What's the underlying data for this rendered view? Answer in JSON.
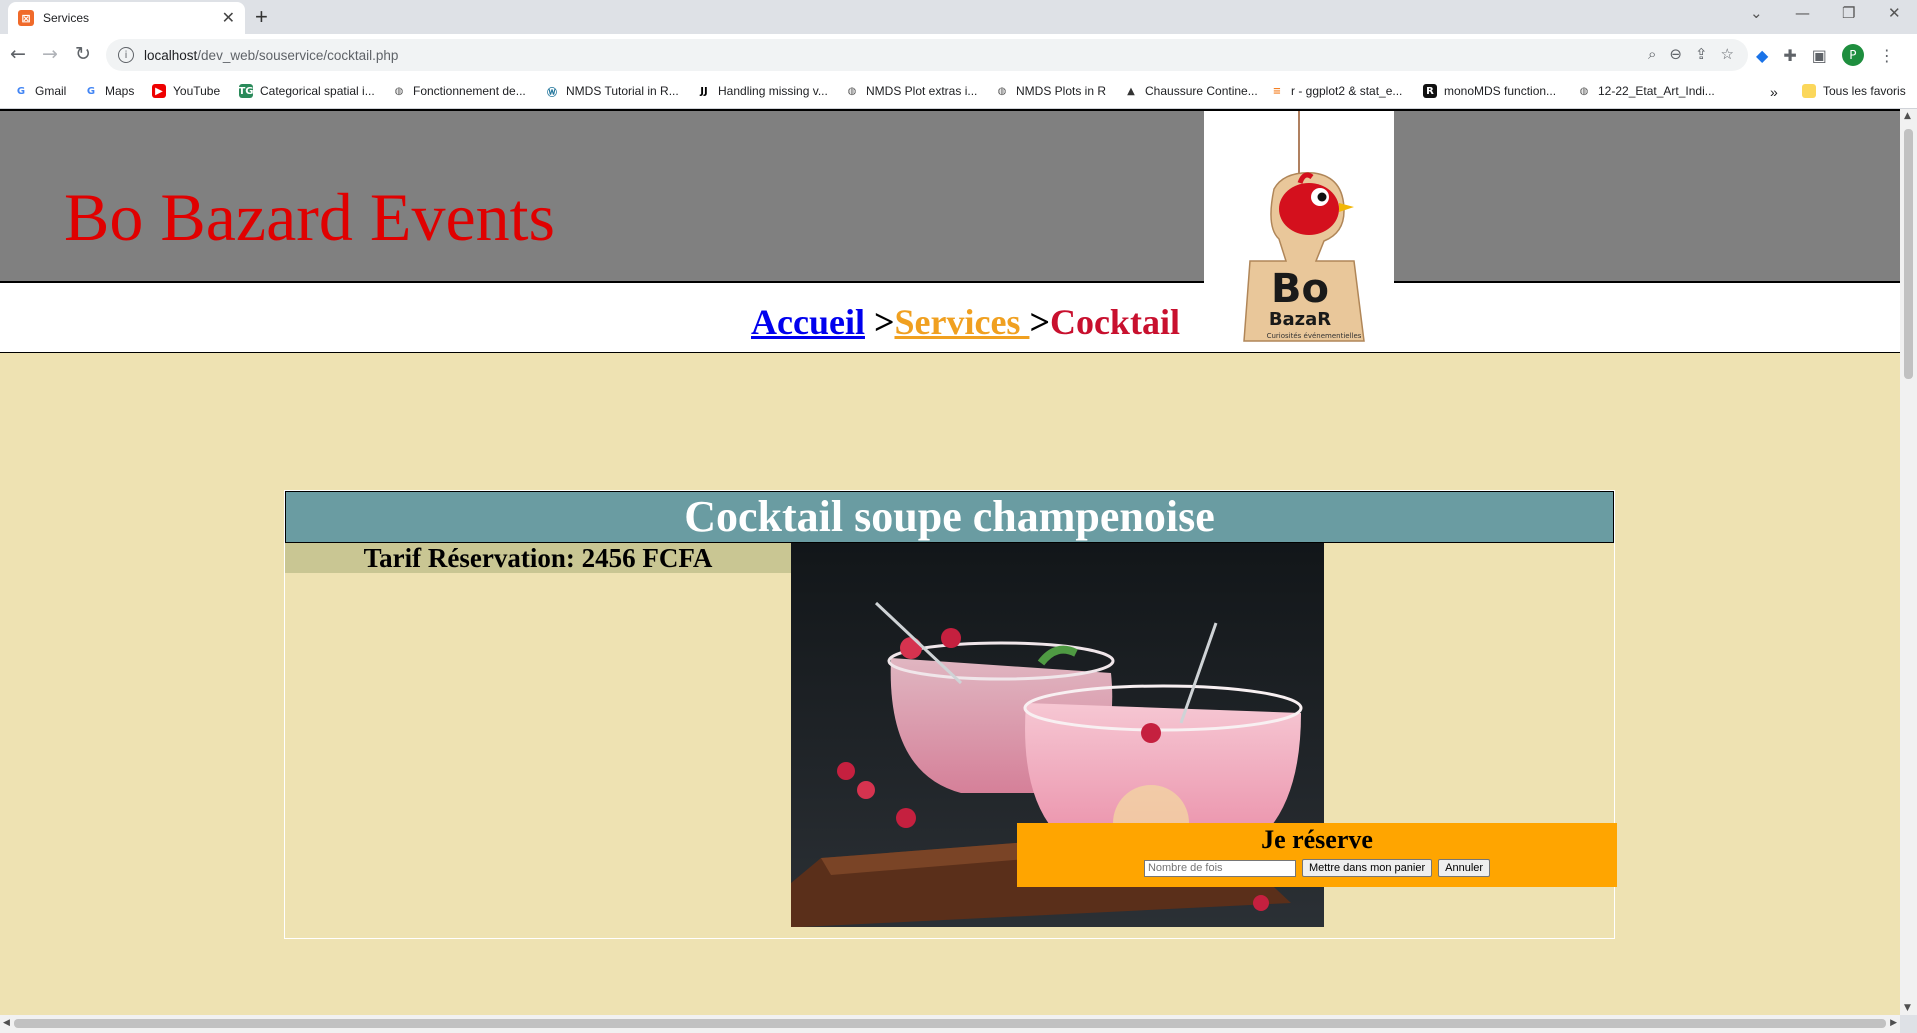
{
  "browser": {
    "tab_title": "Services",
    "tab_favicon": "xampp-icon",
    "url_host": "localhost",
    "url_path": "/dev_web/souservice/cocktail.php",
    "profile_initial": "P",
    "bookmarks": [
      {
        "label": "Gmail",
        "icon": "google-icon"
      },
      {
        "label": "Maps",
        "icon": "google-icon"
      },
      {
        "label": "YouTube",
        "icon": "youtube-icon"
      },
      {
        "label": "Categorical spatial i...",
        "icon": "tg-icon"
      },
      {
        "label": "Fonctionnement de...",
        "icon": "globe-icon"
      },
      {
        "label": "NMDS Tutorial in R...",
        "icon": "wordpress-icon"
      },
      {
        "label": "Handling missing v...",
        "icon": "jj-icon"
      },
      {
        "label": "NMDS Plot extras i...",
        "icon": "globe-icon"
      },
      {
        "label": "NMDS Plots in R",
        "icon": "globe-icon"
      },
      {
        "label": "Chaussure Contine...",
        "icon": "mountain-icon"
      },
      {
        "label": "r - ggplot2 & stat_e...",
        "icon": "stackoverflow-icon"
      },
      {
        "label": "monoMDS function...",
        "icon": "r-icon"
      },
      {
        "label": "12-22_Etat_Art_Indi...",
        "icon": "globe-icon"
      }
    ],
    "overflow_label": "»",
    "all_bookmarks_label": "Tous les favoris"
  },
  "page": {
    "site_title": "Bo Bazard Events",
    "breadcrumb": {
      "home": "Accueil",
      "sep1": " >",
      "services": "Services ",
      "sep2": ">",
      "current": "Cocktail"
    },
    "logo": {
      "line1": "Bo",
      "line2": "BazaR",
      "tagline": "Curiosités événementielles"
    },
    "product": {
      "title": "Cocktail soupe champenoise",
      "tarif": "Tarif Réservation: 2456 FCFA",
      "photo_icon": "cocktail-photo"
    },
    "reserve": {
      "title": "Je réserve",
      "quantity_placeholder": "Nombre de fois",
      "add_button": "Mettre dans mon panier",
      "cancel_button": "Annuler"
    }
  }
}
